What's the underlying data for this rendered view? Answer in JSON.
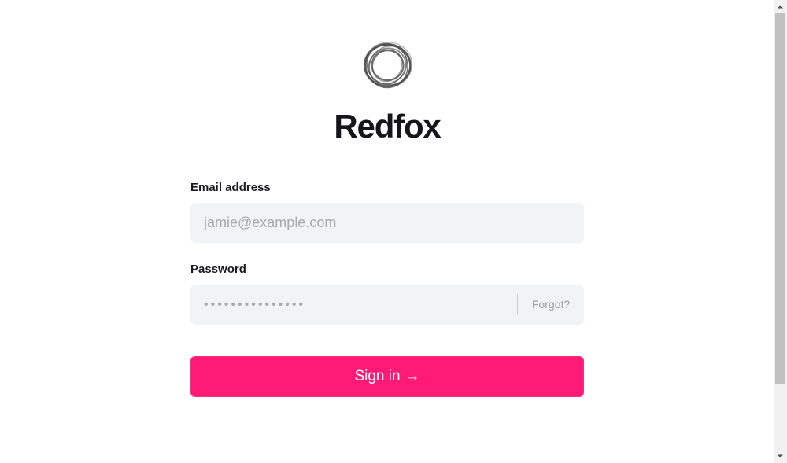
{
  "brand": {
    "logo_icon": "scribble-circle-logo",
    "name": "Redfox"
  },
  "form": {
    "email": {
      "label": "Email address",
      "placeholder": "jamie@example.com",
      "value": ""
    },
    "password": {
      "label": "Password",
      "placeholder": "•••••••••••••••",
      "value": "",
      "forgot_label": "Forgot?"
    },
    "submit": {
      "label": "Sign in",
      "icon": "arrow-right-icon",
      "glyph": "→"
    }
  },
  "colors": {
    "accent": "#ff1a75",
    "input_background": "#f1f4f5",
    "title": "#16161a"
  }
}
